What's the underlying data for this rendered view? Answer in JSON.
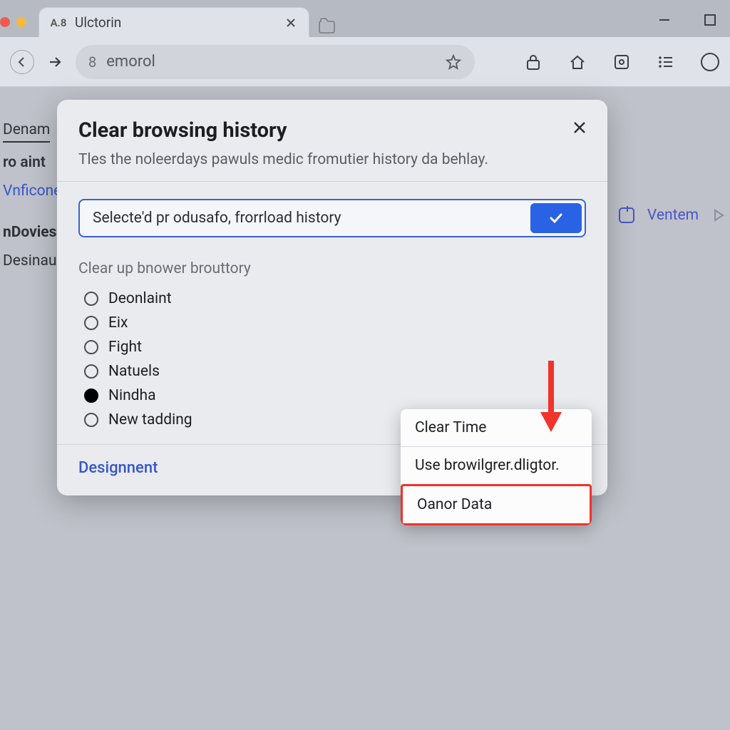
{
  "window": {
    "tab_favicon": "A.8",
    "tab_title": "Ulctorin"
  },
  "omnibox": {
    "icon_glyph": "8",
    "text": "emorol"
  },
  "bg": {
    "nav1": "Denam",
    "nav2": "ro aint",
    "link1": "Vnficone",
    "heading": "nDovies",
    "sub": "Desinau",
    "right_action": "Ventem"
  },
  "dialog": {
    "title": "Clear browsing history",
    "subtitle": "Tles the noleerdays pawuls medic fromutier history da behlay.",
    "select_text": "Selecte'd pr odusafo, frorrload history",
    "section_label": "Clear up bnower brouttory",
    "options": [
      {
        "label": "Deonlaint",
        "checked": false
      },
      {
        "label": "Eix",
        "checked": false
      },
      {
        "label": "Fight",
        "checked": false
      },
      {
        "label": "Natuels",
        "checked": false
      },
      {
        "label": "Nindha",
        "checked": true
      },
      {
        "label": "New tadding",
        "checked": false
      }
    ],
    "footer_link": "Designnent"
  },
  "context_menu": {
    "item1": "Clear Time",
    "item2": "Use browilgrer.dligtor.",
    "item3": "Oanor Data"
  },
  "colors": {
    "accent": "#2a62e6",
    "link": "#3656c9",
    "highlight": "#f0332b"
  }
}
